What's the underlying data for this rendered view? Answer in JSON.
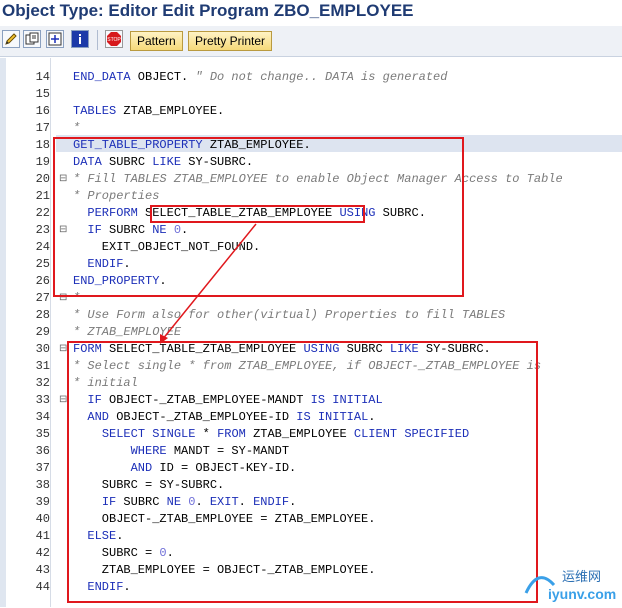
{
  "window": {
    "title": "Object Type: Editor Edit Program ZBO_EMPLOYEE"
  },
  "toolbar": {
    "icons": [
      "edit-pencil-icon",
      "display-change-icon",
      "other-object-icon",
      "info-icon",
      "stop-icon"
    ],
    "pattern_label": "Pattern",
    "pretty_printer_label": "Pretty Printer"
  },
  "editor": {
    "lines": [
      {
        "n": "14",
        "code": "END_DATA OBJECT. \" Do not change.. DATA is generated"
      },
      {
        "n": "15",
        "code": ""
      },
      {
        "n": "16",
        "code": "TABLES ZTAB_EMPLOYEE."
      },
      {
        "n": "17",
        "code": "*"
      },
      {
        "n": "18",
        "code": "GET_TABLE_PROPERTY ZTAB_EMPLOYEE."
      },
      {
        "n": "19",
        "code": "DATA SUBRC LIKE SY-SUBRC."
      },
      {
        "n": "20",
        "code": "* Fill TABLES ZTAB_EMPLOYEE to enable Object Manager Access to Table"
      },
      {
        "n": "21",
        "code": "* Properties"
      },
      {
        "n": "22",
        "code": "  PERFORM SELECT_TABLE_ZTAB_EMPLOYEE USING SUBRC."
      },
      {
        "n": "23",
        "code": "  IF SUBRC NE 0."
      },
      {
        "n": "24",
        "code": "    EXIT_OBJECT_NOT_FOUND."
      },
      {
        "n": "25",
        "code": "  ENDIF."
      },
      {
        "n": "26",
        "code": "END_PROPERTY."
      },
      {
        "n": "27",
        "code": "*"
      },
      {
        "n": "28",
        "code": "* Use Form also for other(virtual) Properties to fill TABLES"
      },
      {
        "n": "29",
        "code": "* ZTAB_EMPLOYEE"
      },
      {
        "n": "30",
        "code": "FORM SELECT_TABLE_ZTAB_EMPLOYEE USING SUBRC LIKE SY-SUBRC."
      },
      {
        "n": "31",
        "code": "* Select single * from ZTAB_EMPLOYEE, if OBJECT-_ZTAB_EMPLOYEE is"
      },
      {
        "n": "32",
        "code": "* initial"
      },
      {
        "n": "33",
        "code": "  IF OBJECT-_ZTAB_EMPLOYEE-MANDT IS INITIAL"
      },
      {
        "n": "34",
        "code": "  AND OBJECT-_ZTAB_EMPLOYEE-ID IS INITIAL."
      },
      {
        "n": "35",
        "code": "    SELECT SINGLE * FROM ZTAB_EMPLOYEE CLIENT SPECIFIED"
      },
      {
        "n": "36",
        "code": "        WHERE MANDT = SY-MANDT"
      },
      {
        "n": "37",
        "code": "        AND ID = OBJECT-KEY-ID."
      },
      {
        "n": "38",
        "code": "    SUBRC = SY-SUBRC."
      },
      {
        "n": "39",
        "code": "    IF SUBRC NE 0. EXIT. ENDIF."
      },
      {
        "n": "40",
        "code": "    OBJECT-_ZTAB_EMPLOYEE = ZTAB_EMPLOYEE."
      },
      {
        "n": "41",
        "code": "  ELSE."
      },
      {
        "n": "42",
        "code": "    SUBRC = 0."
      },
      {
        "n": "43",
        "code": "    ZTAB_EMPLOYEE = OBJECT-_ZTAB_EMPLOYEE."
      },
      {
        "n": "44",
        "code": "  ENDIF."
      }
    ]
  },
  "watermark": {
    "text_cn": "运维网",
    "text_url": "iyunv.com"
  }
}
